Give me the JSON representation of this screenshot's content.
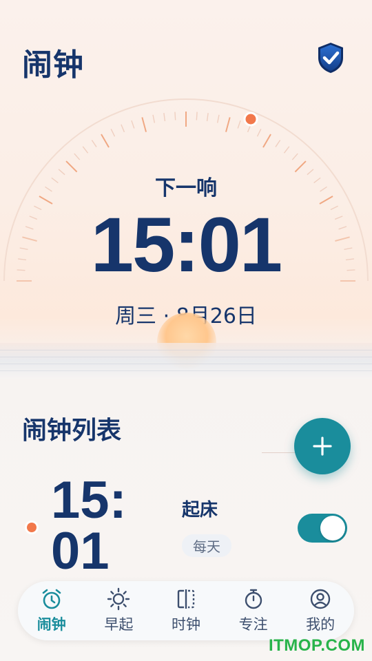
{
  "header": {
    "title": "闹钟",
    "shield_icon": "shield-check-icon"
  },
  "next_alarm": {
    "label": "下一响",
    "time": "15:01",
    "date": "周三 · 8月26日"
  },
  "alarm_list": {
    "title": "闹钟列表",
    "add_icon": "plus-icon",
    "items": [
      {
        "time": "15:01",
        "label": "起床",
        "repeat": "每天",
        "enabled": true
      }
    ]
  },
  "bottom_nav": {
    "items": [
      {
        "label": "闹钟",
        "icon": "alarm-clock-icon",
        "active": true
      },
      {
        "label": "早起",
        "icon": "sun-icon",
        "active": false
      },
      {
        "label": "时钟",
        "icon": "clock-panel-icon",
        "active": false
      },
      {
        "label": "专注",
        "icon": "stopwatch-icon",
        "active": false
      },
      {
        "label": "我的",
        "icon": "user-icon",
        "active": false
      }
    ]
  },
  "watermark": "ITMOP.COM",
  "colors": {
    "primary_text": "#16356b",
    "accent": "#1a8d9c",
    "marker": "#f2784b",
    "watermark": "#28b34a"
  }
}
